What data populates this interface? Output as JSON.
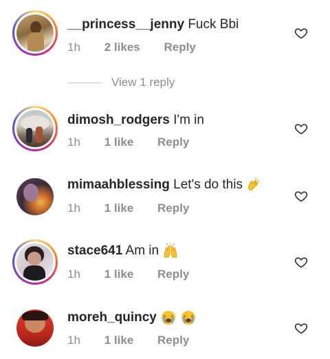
{
  "comments": [
    {
      "username": "__princess__jenny",
      "text": "Fuck Bbi",
      "emoji": "",
      "time": "1h",
      "likes": "2 likes",
      "reply": "Reply",
      "story_ring": true
    },
    {
      "username": "dimosh_rodgers",
      "text": "I'm in",
      "emoji": "",
      "time": "1h",
      "likes": "1 like",
      "reply": "Reply",
      "story_ring": true
    },
    {
      "username": "mimaahblessing",
      "text": "Let's do this",
      "emoji": "clapping-hands",
      "time": "1h",
      "likes": "1 like",
      "reply": "Reply",
      "story_ring": false
    },
    {
      "username": "stace641",
      "text": "Am in",
      "emoji": "raised-hands",
      "time": "1h",
      "likes": "1 like",
      "reply": "Reply",
      "story_ring": true
    },
    {
      "username": "moreh_quincy",
      "text": "",
      "emoji": "crying-faces",
      "time": "1h",
      "likes": "1 like",
      "reply": "Reply",
      "story_ring": false
    }
  ],
  "view_replies": "View 1 reply",
  "colors": {
    "text": "#262626",
    "secondary": "#8e8e8e",
    "divider": "#c7c7c7"
  }
}
